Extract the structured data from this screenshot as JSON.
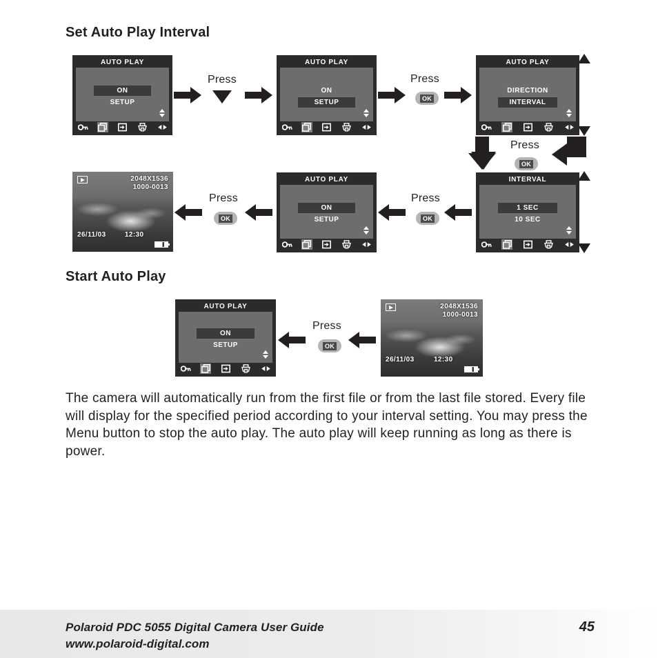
{
  "page": {
    "headings": {
      "set_interval": "Set Auto Play Interval",
      "start_play": "Start Auto Play"
    },
    "body_paragraph": "The camera will automatically run from the first file or from the last file stored. Every file will display for the specified period according to your interval setting. You may press the Menu button to stop the auto play. The auto play will keep running as long as there is power.",
    "footer": {
      "line1": "Polaroid PDC 5055 Digital Camera User Guide",
      "line2": "www.polaroid-digital.com",
      "page_number": "45"
    }
  },
  "labels": {
    "press": "Press",
    "ok": "OK"
  },
  "icons": {
    "key": "key-icon",
    "multi_frame": "multi-frame-icon",
    "transfer": "transfer-icon",
    "printer": "printer-icon",
    "left_right": "left-right-arrows-icon",
    "playback": "playback-icon",
    "battery": "battery-icon",
    "up_down": "up-down-arrows-icon",
    "down_button": "down-button-icon"
  },
  "screens": {
    "s1": {
      "title": "AUTO PLAY",
      "items": [
        {
          "label": "ON",
          "selected": true
        },
        {
          "label": "SETUP",
          "selected": false
        }
      ]
    },
    "s2": {
      "title": "AUTO PLAY",
      "items": [
        {
          "label": "ON",
          "selected": false
        },
        {
          "label": "SETUP",
          "selected": true
        }
      ]
    },
    "s3": {
      "title": "AUTO PLAY",
      "items": [
        {
          "label": "DIRECTION",
          "selected": false
        },
        {
          "label": "INTERVAL",
          "selected": true
        }
      ]
    },
    "s4": {
      "title": "INTERVAL",
      "items": [
        {
          "label": "1 SEC",
          "selected": true
        },
        {
          "label": "10 SEC",
          "selected": false
        }
      ]
    },
    "s5": {
      "title": "AUTO PLAY",
      "items": [
        {
          "label": "ON",
          "selected": true
        },
        {
          "label": "SETUP",
          "selected": false
        }
      ]
    },
    "s6": {
      "title": "AUTO PLAY",
      "items": [
        {
          "label": "ON",
          "selected": true
        },
        {
          "label": "SETUP",
          "selected": false
        }
      ]
    }
  },
  "photos": {
    "p1": {
      "resolution": "2048X1536",
      "file_number": "1000-0013",
      "date": "26/11/03",
      "time": "12:30"
    },
    "p2": {
      "resolution": "2048X1536",
      "file_number": "1000-0013",
      "date": "26/11/03",
      "time": "12:30"
    }
  },
  "colors": {
    "lcd_frame": "#2b2b2b",
    "lcd_body": "#6d6d6d",
    "highlight": "#3b3b3b",
    "ink": "#231f20",
    "ok_button": "#b4b4b4"
  }
}
